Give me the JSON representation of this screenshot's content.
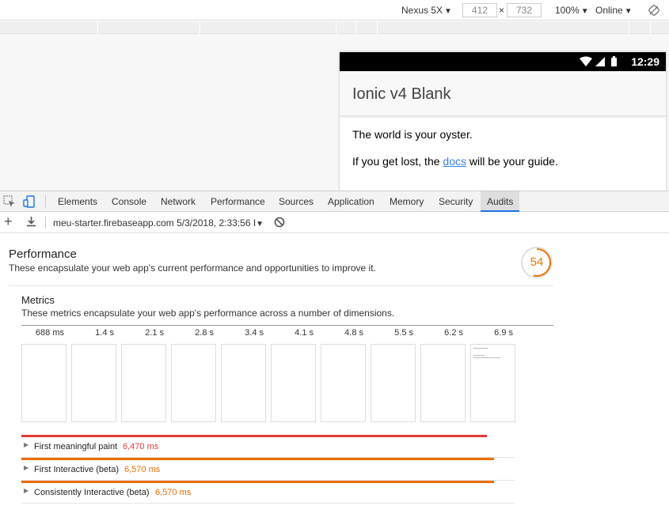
{
  "device_toolbar": {
    "device": "Nexus 5X",
    "width": "412",
    "height": "732",
    "times": "×",
    "zoom": "100%",
    "network": "Online",
    "dropdown_arrow": "▼",
    "rotate_icon": "rotate-icon"
  },
  "phone": {
    "time": "12:29",
    "app_title": "Ionic v4 Blank",
    "line1": "The world is your oyster.",
    "line2_before": "If you get lost, the ",
    "line2_link": "docs",
    "line2_after": " will be your guide."
  },
  "tabs": [
    "Elements",
    "Console",
    "Network",
    "Performance",
    "Sources",
    "Application",
    "Memory",
    "Security",
    "Audits"
  ],
  "active_tab": "Audits",
  "audit_toolbar": {
    "report_label": "meu-starter.firebaseapp.com 5/3/2018, 2:33:56 I"
  },
  "report": {
    "title": "Performance",
    "description": "These encapsulate your web app's current performance and opportunities to improve it.",
    "score": "54",
    "score_fraction": 0.54,
    "metrics": {
      "title": "Metrics",
      "description": "These metrics encapsulate your web app's performance across a number of dimensions.",
      "filmstrip": [
        "688 ms",
        "1.4 s",
        "2.1 s",
        "2.8 s",
        "3.4 s",
        "4.1 s",
        "4.8 s",
        "5.5 s",
        "6.2 s",
        "6.9 s"
      ],
      "rows": [
        {
          "name": "First meaningful paint",
          "value": "6,470 ms",
          "color": "#e53935",
          "fraction": 0.944
        },
        {
          "name": "First Interactive (beta)",
          "value": "6,570 ms",
          "color": "#ef6c00",
          "fraction": 0.958
        },
        {
          "name": "Consistently Interactive (beta)",
          "value": "6,570 ms",
          "color": "#ef6c00",
          "fraction": 0.958
        }
      ]
    }
  },
  "colors": {
    "score": "#e67700",
    "accent": "#1a73e8",
    "link": "#3880ff"
  }
}
